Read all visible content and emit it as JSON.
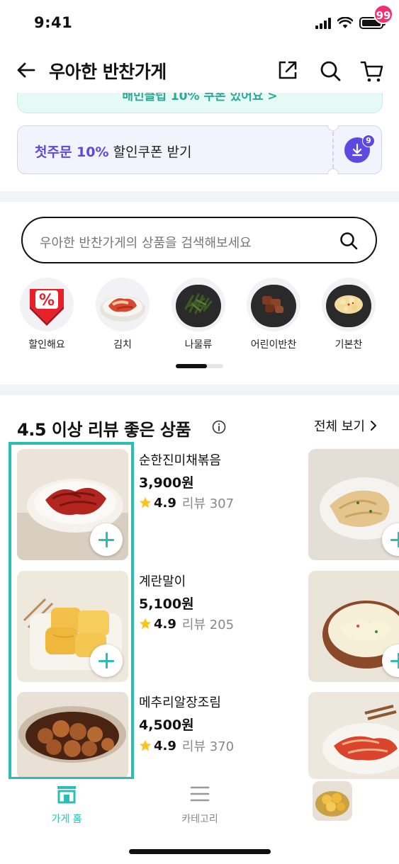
{
  "status": {
    "time": "9:41"
  },
  "header": {
    "title": "우아한 반찬가게",
    "cart_count": "99"
  },
  "banner": {
    "text": "배민클럽 10% 쿠폰 있어요 >"
  },
  "coupon": {
    "highlight": "첫주문 10%",
    "text": " 할인쿠폰 받기",
    "badge": "9"
  },
  "search": {
    "placeholder": "우아한 반찬가게의 상품을 검색해보세요"
  },
  "categories": [
    {
      "label": "할인해요",
      "icon": "discount-icon"
    },
    {
      "label": "김치",
      "icon": "kimchi-image"
    },
    {
      "label": "나물류",
      "icon": "namul-image"
    },
    {
      "label": "어린이반찬",
      "icon": "kids-dish-image"
    },
    {
      "label": "기본찬",
      "icon": "basic-dish-image"
    }
  ],
  "section": {
    "title": "4.5 이상 리뷰 좋은 상품",
    "see_all": "전체 보기"
  },
  "products": [
    {
      "name": "순한진미채볶음",
      "price": "3,900원",
      "rating": "4.9",
      "reviews": "리뷰 307"
    },
    {
      "name": "계란말이",
      "price": "5,100원",
      "rating": "4.9",
      "reviews": "리뷰 205"
    },
    {
      "name": "메추리알장조림",
      "price": "4,500원",
      "rating": "4.9",
      "reviews": "리뷰 370"
    }
  ],
  "tabs": [
    {
      "label": "가게 홈",
      "icon": "store-icon",
      "active": true
    },
    {
      "label": "카테고리",
      "icon": "menu-icon",
      "active": false
    }
  ],
  "colors": {
    "accent": "#2bbfb3",
    "coupon": "#5b49e0",
    "badge": "#f0306f"
  }
}
